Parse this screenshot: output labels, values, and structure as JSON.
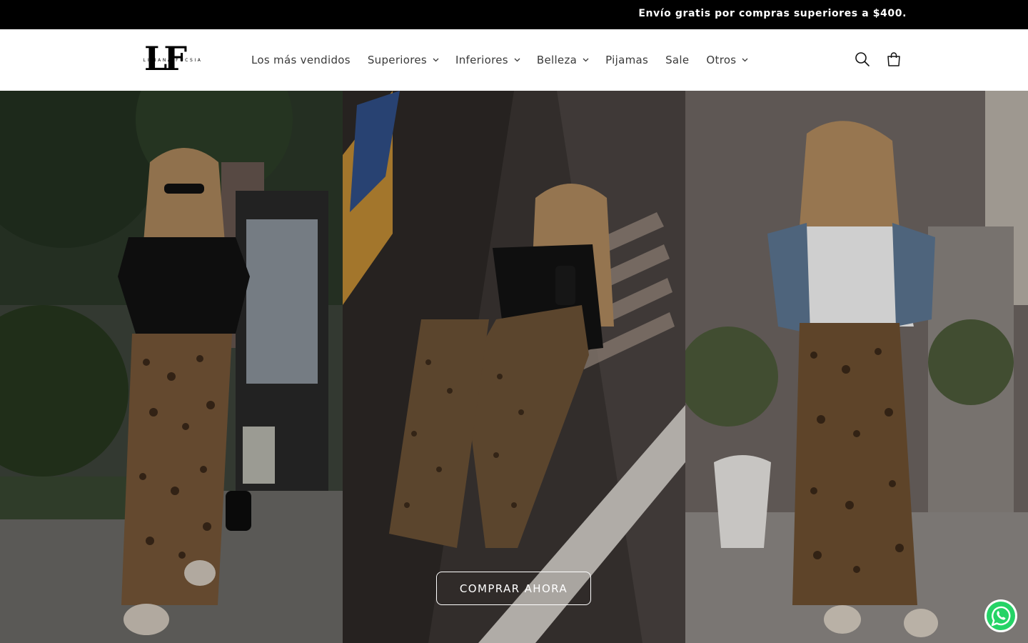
{
  "announcement": {
    "text": "Envío gratis por compras superiores a $400."
  },
  "brand": {
    "logo_letters": "LF",
    "logo_tagline": "LILIANA FUCSIA"
  },
  "nav": {
    "items": [
      {
        "label": "Los más vendidos",
        "dropdown": false
      },
      {
        "label": "Superiores",
        "dropdown": true
      },
      {
        "label": "Inferiores",
        "dropdown": true
      },
      {
        "label": "Belleza",
        "dropdown": true
      },
      {
        "label": "Pijamas",
        "dropdown": false
      },
      {
        "label": "Sale",
        "dropdown": false
      },
      {
        "label": "Otros",
        "dropdown": true
      }
    ]
  },
  "header_icons": {
    "search": "search-icon",
    "cart": "cart-icon"
  },
  "hero": {
    "cta_label": "COMPRAR AHORA"
  },
  "floating": {
    "whatsapp": "whatsapp-icon"
  },
  "colors": {
    "announcement_bg": "#000000",
    "announcement_text": "#ffffff",
    "nav_text": "#3a3a3a",
    "cta_border": "#ffffff",
    "whatsapp_green": "#25D366"
  }
}
